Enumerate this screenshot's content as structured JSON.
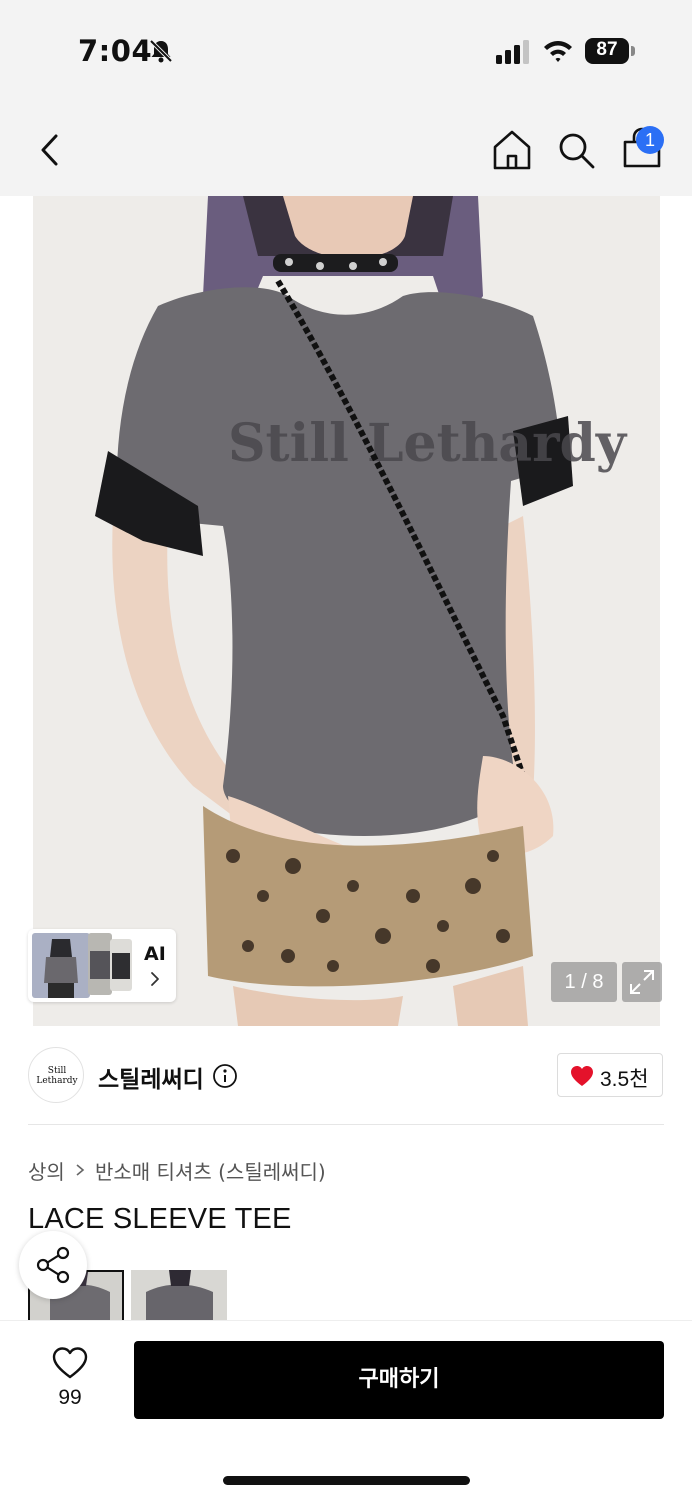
{
  "status_bar": {
    "time": "7:04",
    "battery": "87",
    "icons": [
      "bell-slash-icon",
      "signal-icon",
      "wifi-icon",
      "battery-icon"
    ]
  },
  "nav": {
    "icons": [
      "back-chevron-icon",
      "home-icon",
      "search-icon",
      "shopping-bag-icon"
    ],
    "cart_badge": "1",
    "accent_color": "#2b6ff5"
  },
  "gallery": {
    "ai_label": "AI",
    "counter": "1 / 8",
    "print_text": "Still Lethardy",
    "icons": [
      "chevron-right-icon",
      "expand-icon"
    ]
  },
  "brand": {
    "logo_text": "Still Lethardy",
    "name": "스틸레써디",
    "like_count": "3.5천",
    "icons": [
      "info-icon",
      "heart-filled-icon"
    ],
    "heart_color": "#e4122b"
  },
  "breadcrumb": {
    "items": [
      "상의",
      "반소매 티셔츠 (스틸레써디)"
    ]
  },
  "product": {
    "title": "LACE SLEEVE TEE"
  },
  "share": {
    "icon": "share-icon"
  },
  "bottom": {
    "wish_count": "99",
    "buy_label": "구매하기",
    "icons": [
      "heart-outline-icon"
    ]
  }
}
